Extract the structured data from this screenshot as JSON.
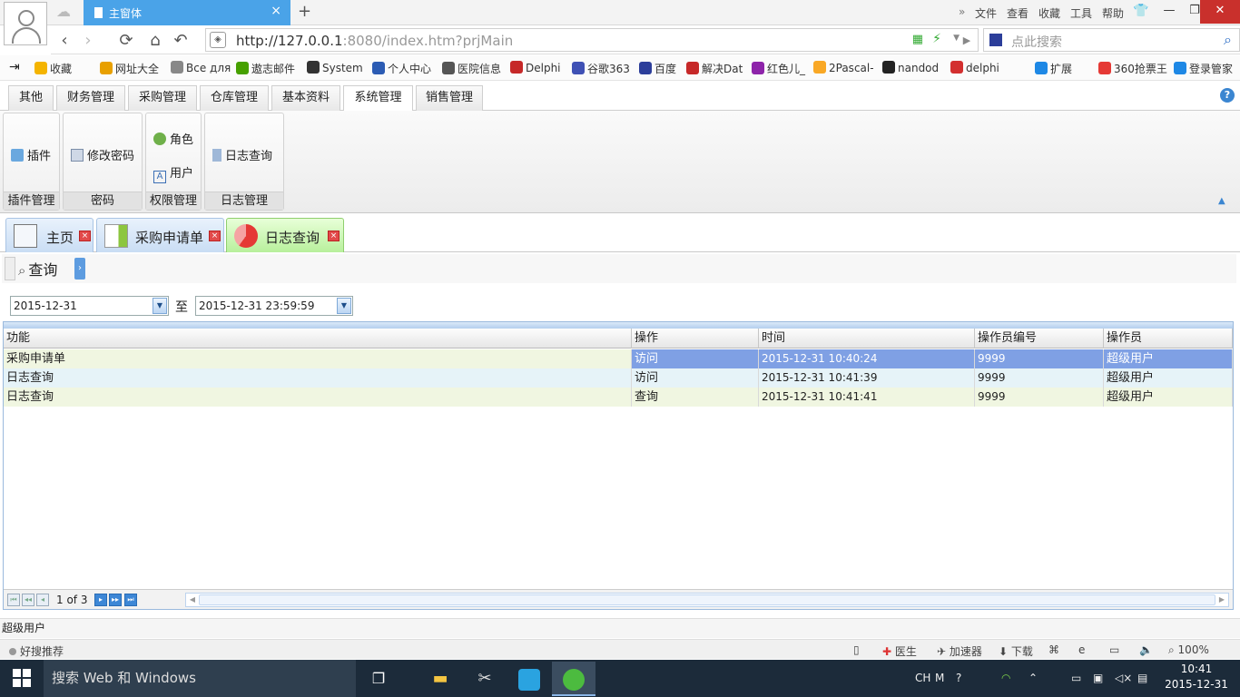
{
  "browser": {
    "tab_title": "主窗体",
    "menu": [
      "文件",
      "查看",
      "收藏",
      "工具",
      "帮助"
    ],
    "address_host": "http://127.0.0.1",
    "address_rest": ":8080/index.htm?prjMain",
    "search_placeholder": "点此搜索"
  },
  "bookmarks": [
    {
      "label": "收藏",
      "color": "#f4b400"
    },
    {
      "label": "网址大全",
      "color": "#e8a000"
    },
    {
      "label": "Все для",
      "color": "#888888"
    },
    {
      "label": "遨志邮件",
      "color": "#46a000"
    },
    {
      "label": "System",
      "color": "#333333"
    },
    {
      "label": "个人中心",
      "color": "#2c5cb4"
    },
    {
      "label": "医院信息",
      "color": "#555555"
    },
    {
      "label": "Delphi",
      "color": "#c62828"
    },
    {
      "label": "谷歌363",
      "color": "#3f51b5"
    },
    {
      "label": "百度",
      "color": "#2c3e9a"
    },
    {
      "label": "解决Dat",
      "color": "#c62828"
    },
    {
      "label": "红色儿_",
      "color": "#8e24aa"
    },
    {
      "label": "2Pascal-",
      "color": "#f9a825"
    },
    {
      "label": "nandod",
      "color": "#222222"
    },
    {
      "label": "delphi",
      "color": "#d32f2f"
    },
    {
      "label": "扩展",
      "color": "#1e88e5"
    },
    {
      "label": "360抢票王",
      "color": "#e53935"
    },
    {
      "label": "登录管家",
      "color": "#1e88e5"
    }
  ],
  "ribbon": {
    "tabs": [
      "其他",
      "财务管理",
      "采购管理",
      "仓库管理",
      "基本资料",
      "系统管理",
      "销售管理"
    ],
    "active_tab": "系统管理",
    "groups": [
      {
        "label": "插件管理",
        "buttons": [
          "插件"
        ]
      },
      {
        "label": "密码",
        "buttons": [
          "修改密码"
        ]
      },
      {
        "label": "权限管理",
        "buttons": [
          "角色",
          "用户"
        ]
      },
      {
        "label": "日志管理",
        "buttons": [
          "日志查询"
        ]
      }
    ]
  },
  "doc_tabs": [
    "主页",
    "采购申请单",
    "日志查询"
  ],
  "toolbar": {
    "query_label": "查询"
  },
  "filter": {
    "date_from": "2015-12-31",
    "to_label": "至",
    "date_to": "2015-12-31 23:59:59"
  },
  "grid": {
    "columns": [
      "功能",
      "操作",
      "时间",
      "操作员编号",
      "操作员"
    ],
    "rows": [
      [
        "采购申请单",
        "访问",
        "2015-12-31 10:40:24",
        "9999",
        "超级用户"
      ],
      [
        "日志查询",
        "访问",
        "2015-12-31 10:41:39",
        "9999",
        "超级用户"
      ],
      [
        "日志查询",
        "查询",
        "2015-12-31 10:41:41",
        "9999",
        "超级用户"
      ]
    ],
    "selected_row": 0,
    "page_info": "1 of 3"
  },
  "status": {
    "user": "超级用户"
  },
  "browser_status": {
    "left": "好搜推荐",
    "items": [
      "医生",
      "加速器",
      "下载",
      "100%"
    ]
  },
  "taskbar": {
    "search_placeholder": "搜索 Web 和 Windows",
    "time": "10:41",
    "date": "2015-12-31",
    "ime": "CH"
  }
}
